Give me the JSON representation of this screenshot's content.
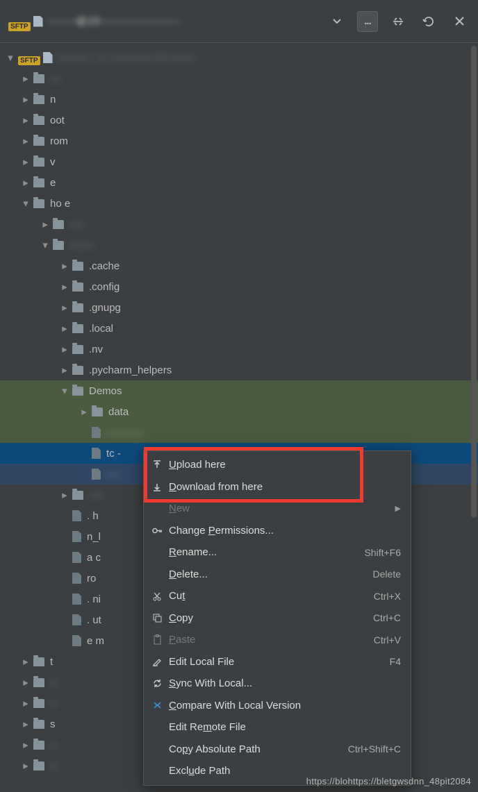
{
  "toolbar": {
    "connection_label": "-------@15-------------------",
    "dots": "..."
  },
  "tree": {
    "root_label": "--------- : --- -------------- / --------",
    "items": [
      {
        "label": "---",
        "depth": 1,
        "chev": "r",
        "icon": "folder",
        "blur": true
      },
      {
        "label": "n",
        "depth": 1,
        "chev": "r",
        "icon": "folder"
      },
      {
        "label": "oot",
        "depth": 1,
        "chev": "r",
        "icon": "folder"
      },
      {
        "label": "rom",
        "depth": 1,
        "chev": "r",
        "icon": "folder"
      },
      {
        "label": "v",
        "depth": 1,
        "chev": "r",
        "icon": "folder"
      },
      {
        "label": "e",
        "depth": 1,
        "chev": "r",
        "icon": "folder"
      },
      {
        "label": "ho   e",
        "depth": 1,
        "chev": "d",
        "icon": "folder"
      },
      {
        "label": "----",
        "depth": 2,
        "chev": "r",
        "icon": "folder",
        "blur": true
      },
      {
        "label": "-------",
        "depth": 2,
        "chev": "d",
        "icon": "folder",
        "blur": true
      },
      {
        "label": ".cache",
        "depth": 3,
        "chev": "r",
        "icon": "folder"
      },
      {
        "label": ".config",
        "depth": 3,
        "chev": "r",
        "icon": "folder"
      },
      {
        "label": ".gnupg",
        "depth": 3,
        "chev": "r",
        "icon": "folder"
      },
      {
        "label": ".local",
        "depth": 3,
        "chev": "r",
        "icon": "folder"
      },
      {
        "label": ".nv",
        "depth": 3,
        "chev": "r",
        "icon": "folder"
      },
      {
        "label": ".pycharm_helpers",
        "depth": 3,
        "chev": "r",
        "icon": "folder"
      },
      {
        "label": "Demos",
        "depth": 3,
        "chev": "d",
        "icon": "folder",
        "row": "green"
      },
      {
        "label": "data",
        "depth": 4,
        "chev": "r",
        "icon": "folder",
        "row": "green"
      },
      {
        "label": "-----------",
        "depth": 4,
        "chev": "",
        "icon": "file",
        "blur": true,
        "row": "green"
      },
      {
        "label": "tc    -",
        "depth": 4,
        "chev": "",
        "icon": "file",
        "row": "blue"
      },
      {
        "label": "----",
        "depth": 4,
        "chev": "",
        "icon": "file",
        "blur": true,
        "row": "sel"
      },
      {
        "label": "----",
        "depth": 3,
        "chev": "r",
        "icon": "folder",
        "blur": true
      },
      {
        "label": ".   h",
        "depth": 3,
        "chev": "",
        "icon": "fileq"
      },
      {
        "label": "  n_l",
        "depth": 3,
        "chev": "",
        "icon": "fileq"
      },
      {
        "label": "a    c",
        "depth": 3,
        "chev": "",
        "icon": "fileq"
      },
      {
        "label": "ro ",
        "depth": 3,
        "chev": "",
        "icon": "fileq"
      },
      {
        "label": "   . ni",
        "depth": 3,
        "chev": "",
        "icon": "fileq"
      },
      {
        "label": ".   ut",
        "depth": 3,
        "chev": "",
        "icon": "fileq"
      },
      {
        "label": "e   m",
        "depth": 3,
        "chev": "",
        "icon": "file"
      },
      {
        "label": "t",
        "depth": 1,
        "chev": "r",
        "icon": "folder"
      },
      {
        "label": "--",
        "depth": 1,
        "chev": "r",
        "icon": "folder",
        "blur": true
      },
      {
        "label": "--",
        "depth": 1,
        "chev": "r",
        "icon": "folder",
        "blur": true
      },
      {
        "label": "s",
        "depth": 1,
        "chev": "r",
        "icon": "folder"
      },
      {
        "label": "--",
        "depth": 1,
        "chev": "r",
        "icon": "folder",
        "blur": true
      },
      {
        "label": "--",
        "depth": 1,
        "chev": "r",
        "icon": "folder",
        "blur": true
      }
    ]
  },
  "menu": [
    {
      "icon": "upload",
      "label_pre": "",
      "u": "U",
      "label_post": "pload here"
    },
    {
      "icon": "download",
      "label_pre": "",
      "u": "D",
      "label_post": "ownload from here"
    },
    {
      "icon": "",
      "label_pre": "",
      "u": "N",
      "label_post": "ew",
      "disabled": true,
      "sub": true
    },
    {
      "icon": "key",
      "label_pre": "Change ",
      "u": "P",
      "label_post": "ermissions..."
    },
    {
      "icon": "",
      "label_pre": "",
      "u": "R",
      "label_post": "ename...",
      "shortcut": "Shift+F6"
    },
    {
      "icon": "",
      "label_pre": "",
      "u": "D",
      "label_post": "elete...",
      "shortcut": "Delete"
    },
    {
      "icon": "cut",
      "label_pre": "Cu",
      "u": "t",
      "label_post": "",
      "shortcut": "Ctrl+X"
    },
    {
      "icon": "copy",
      "label_pre": "",
      "u": "C",
      "label_post": "opy",
      "shortcut": "Ctrl+C"
    },
    {
      "icon": "paste",
      "label_pre": "",
      "u": "P",
      "label_post": "aste",
      "disabled": true,
      "shortcut": "Ctrl+V"
    },
    {
      "icon": "edit",
      "label_pre": "Edit Local File",
      "u": "",
      "label_post": "",
      "shortcut": "F4"
    },
    {
      "icon": "sync",
      "label_pre": "",
      "u": "S",
      "label_post": "ync With Local..."
    },
    {
      "icon": "compare",
      "label_pre": "",
      "u": "C",
      "label_post": "ompare With Local Version"
    },
    {
      "icon": "",
      "label_pre": "Edit Re",
      "u": "m",
      "label_post": "ote File"
    },
    {
      "icon": "",
      "label_pre": "Co",
      "u": "p",
      "label_post": "y Absolute Path",
      "shortcut": "Ctrl+Shift+C"
    },
    {
      "icon": "",
      "label_pre": "Excl",
      "u": "u",
      "label_post": "de Path"
    }
  ],
  "watermark": "https://blohttps://bletgwsdnn_48pit2084"
}
